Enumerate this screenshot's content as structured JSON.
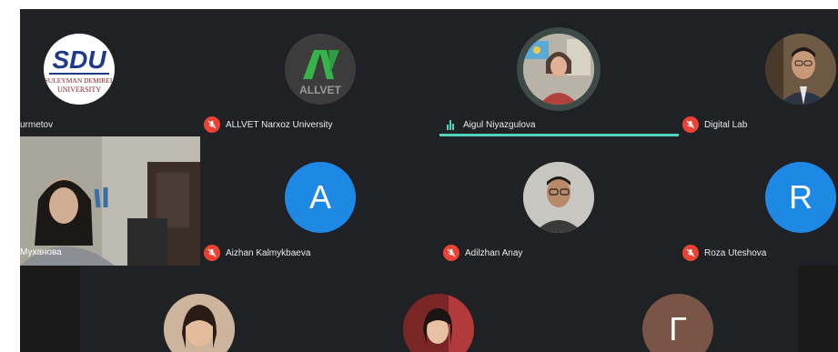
{
  "participants": [
    {
      "name": "urmetov",
      "muted": false
    },
    {
      "name": "ALLVET Narxoz University",
      "muted": true
    },
    {
      "name": "Aigul Niyazgulova",
      "muted": false,
      "speaking": true
    },
    {
      "name": "Digital Lab",
      "muted": true
    },
    {
      "name": "Муханова",
      "muted": false,
      "video": true
    },
    {
      "name": "Aizhan Kalmykbaeva",
      "muted": true,
      "initial": "A",
      "color": "#1e88e5"
    },
    {
      "name": "Adilzhan Anay",
      "muted": true
    },
    {
      "name": "Roza Uteshova",
      "muted": true,
      "initial": "R",
      "color": "#1e88e5"
    },
    {
      "name": "",
      "muted": false
    },
    {
      "name": "",
      "muted": false
    },
    {
      "name": "",
      "muted": false,
      "initial": "Г",
      "color": "#795548"
    }
  ],
  "logos": {
    "sdu_lines": [
      "SDU",
      "SULEYMAN DEMIREL",
      "UNIVERSITY"
    ],
    "allvet_text": "ALLVET"
  },
  "colors": {
    "background": "#202124",
    "muted_icon": "#ea4335",
    "speaking": "#4fd4bd"
  }
}
